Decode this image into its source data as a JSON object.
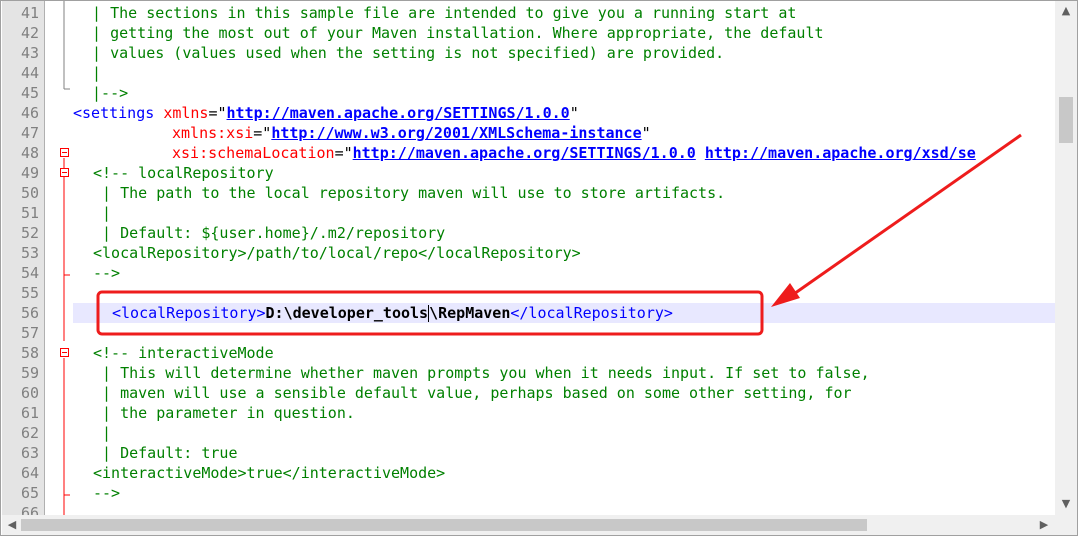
{
  "gutter": {
    "line_numbers": [
      "41",
      "42",
      "43",
      "44",
      "45",
      "46",
      "47",
      "48",
      "49",
      "50",
      "51",
      "52",
      "53",
      "54",
      "55",
      "56",
      "57",
      "58",
      "59",
      "60",
      "61",
      "62",
      "63",
      "64",
      "65",
      "66"
    ]
  },
  "code": {
    "l41": " | The sections in this sample file are intended to give you a running start at",
    "l42": " | getting the most out of your Maven installation. Where appropriate, the default",
    "l43": " | values (values used when the setting is not specified) are provided.",
    "l44": " |",
    "l45": " |-->",
    "l46_tag": "<settings ",
    "l46_attr": "xmlns",
    "l46_eq": "=\"",
    "l46_url": "http://maven.apache.org/SETTINGS/1.0.0",
    "l46_end": "\"",
    "l47_attr": "xmlns:xsi",
    "l47_eq": "=\"",
    "l47_url": "http://www.w3.org/2001/XMLSchema-instance",
    "l47_end": "\"",
    "l48_attr": "xsi:schemaLocation",
    "l48_eq": "=\"",
    "l48_url1": "http://maven.apache.org/SETTINGS/1.0.0",
    "l48_url2": "http://maven.apache.org/xsd/se",
    "l49": "<!-- localRepository",
    "l50": " | The path to the local repository maven will use to store artifacts.",
    "l51": " |",
    "l52": " | Default: ${user.home}/.m2/repository",
    "l53": "<localRepository>/path/to/local/repo</localRepository>",
    "l54": "-->",
    "l56_open": "<localRepository>",
    "l56_val1": "D:\\developer_tools",
    "l56_val2": "\\RepMaven",
    "l56_close": "</localRepository>",
    "l58": "<!-- interactiveMode",
    "l59": " | This will determine whether maven prompts you when it needs input. If set to false,",
    "l60": " | maven will use a sensible default value, perhaps based on some other setting, for",
    "l61": " | the parameter in question.",
    "l62": " |",
    "l63": " | Default: true",
    "l64": "<interactiveMode>true</interactiveMode>",
    "l65": "-->"
  },
  "scroll": {
    "up": "▲",
    "down": "▼",
    "left": "◀",
    "right": "▶"
  },
  "annotation": {
    "color": "#ee1c1c"
  }
}
